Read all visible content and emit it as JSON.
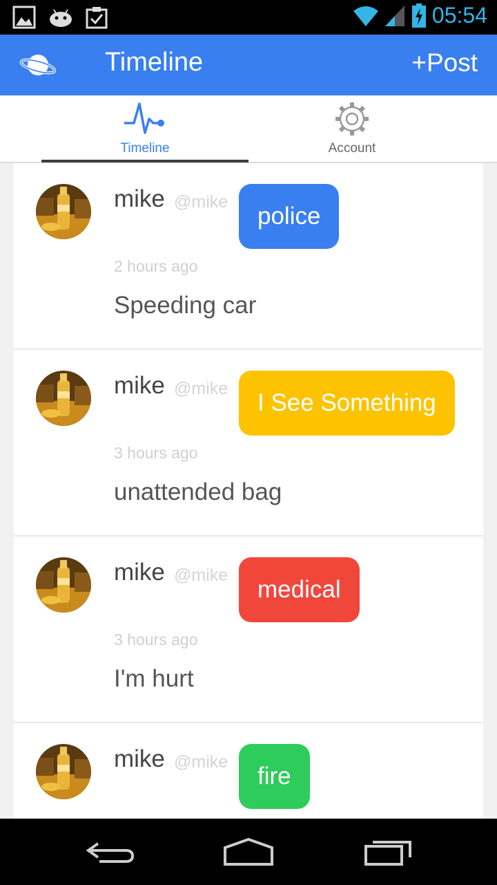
{
  "status_bar": {
    "time": "05:54",
    "icons": [
      "gallery-icon",
      "android-icon",
      "clipboard-check-icon",
      "wifi-icon",
      "signal-icon",
      "battery-charging-icon"
    ],
    "accent": "#33b5e5"
  },
  "app_bar": {
    "logo_icon": "planet-icon",
    "title": "Timeline",
    "post_label": "+Post",
    "color": "#3a7ff0"
  },
  "tabs": [
    {
      "label": "Timeline",
      "icon": "pulse-icon",
      "active": true
    },
    {
      "label": "Account",
      "icon": "gear-icon",
      "active": false
    }
  ],
  "posts": [
    {
      "name": "mike",
      "handle": "@mike",
      "category": "police",
      "category_color": "#3a7ff0",
      "time": "2 hours ago",
      "text": "Speeding car"
    },
    {
      "name": "mike",
      "handle": "@mike",
      "category": "I See Something",
      "category_color": "#fdc300",
      "time": "3 hours ago",
      "text": "unattended bag"
    },
    {
      "name": "mike",
      "handle": "@mike",
      "category": "medical",
      "category_color": "#f1473b",
      "time": "3 hours ago",
      "text": "I'm hurt"
    },
    {
      "name": "mike",
      "handle": "@mike",
      "category": "fire",
      "category_color": "#2ecc5a",
      "time": "",
      "text": ""
    }
  ],
  "nav_bar": {
    "buttons": [
      "back-icon",
      "home-icon",
      "recents-icon"
    ]
  }
}
